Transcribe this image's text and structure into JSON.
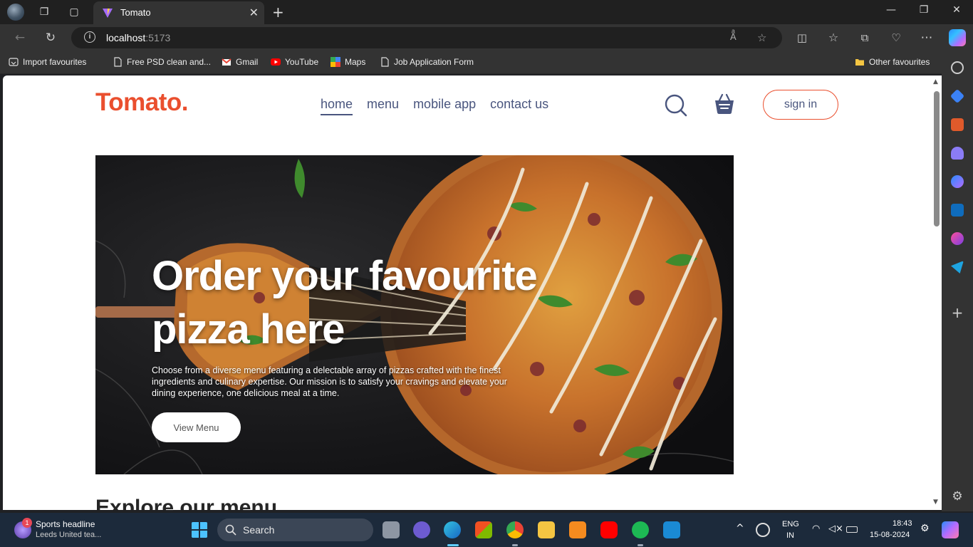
{
  "browser": {
    "tab_title": "Tomato",
    "address_host": "localhost",
    "address_port": ":5173"
  },
  "favourites": [
    {
      "label": "Import favourites",
      "icon": "import-icon"
    },
    {
      "label": "Free PSD clean and...",
      "icon": "page-icon"
    },
    {
      "label": "Gmail",
      "icon": "gmail-icon"
    },
    {
      "label": "YouTube",
      "icon": "youtube-icon"
    },
    {
      "label": "Maps",
      "icon": "maps-icon"
    },
    {
      "label": "Job Application Form",
      "icon": "page-icon"
    },
    {
      "label": "Other favourites",
      "icon": "folder-icon"
    }
  ],
  "site": {
    "logo": "Tomato.",
    "nav": [
      "home",
      "menu",
      "mobile app",
      "contact us"
    ],
    "active_nav": "home",
    "signin_label": "sign in",
    "hero": {
      "heading": "Order your favourite pizza here",
      "description": "Choose from a diverse menu featuring a delectable array of pizzas crafted with the finest ingredients and culinary expertise. Our mission is to satisfy your cravings and elevate your dining experience, one delicious meal at a time.",
      "button": "View Menu"
    },
    "explore_heading": "Explore our menu"
  },
  "colors": {
    "brand": "#ea4f2e",
    "nav_text": "#49557e"
  },
  "taskbar": {
    "news_badge": "1",
    "news_title": "Sports headline",
    "news_sub": "Leeds United tea...",
    "search_label": "Search",
    "lang_line1": "ENG",
    "lang_line2": "IN",
    "time": "18:43",
    "date": "15-08-2024"
  }
}
